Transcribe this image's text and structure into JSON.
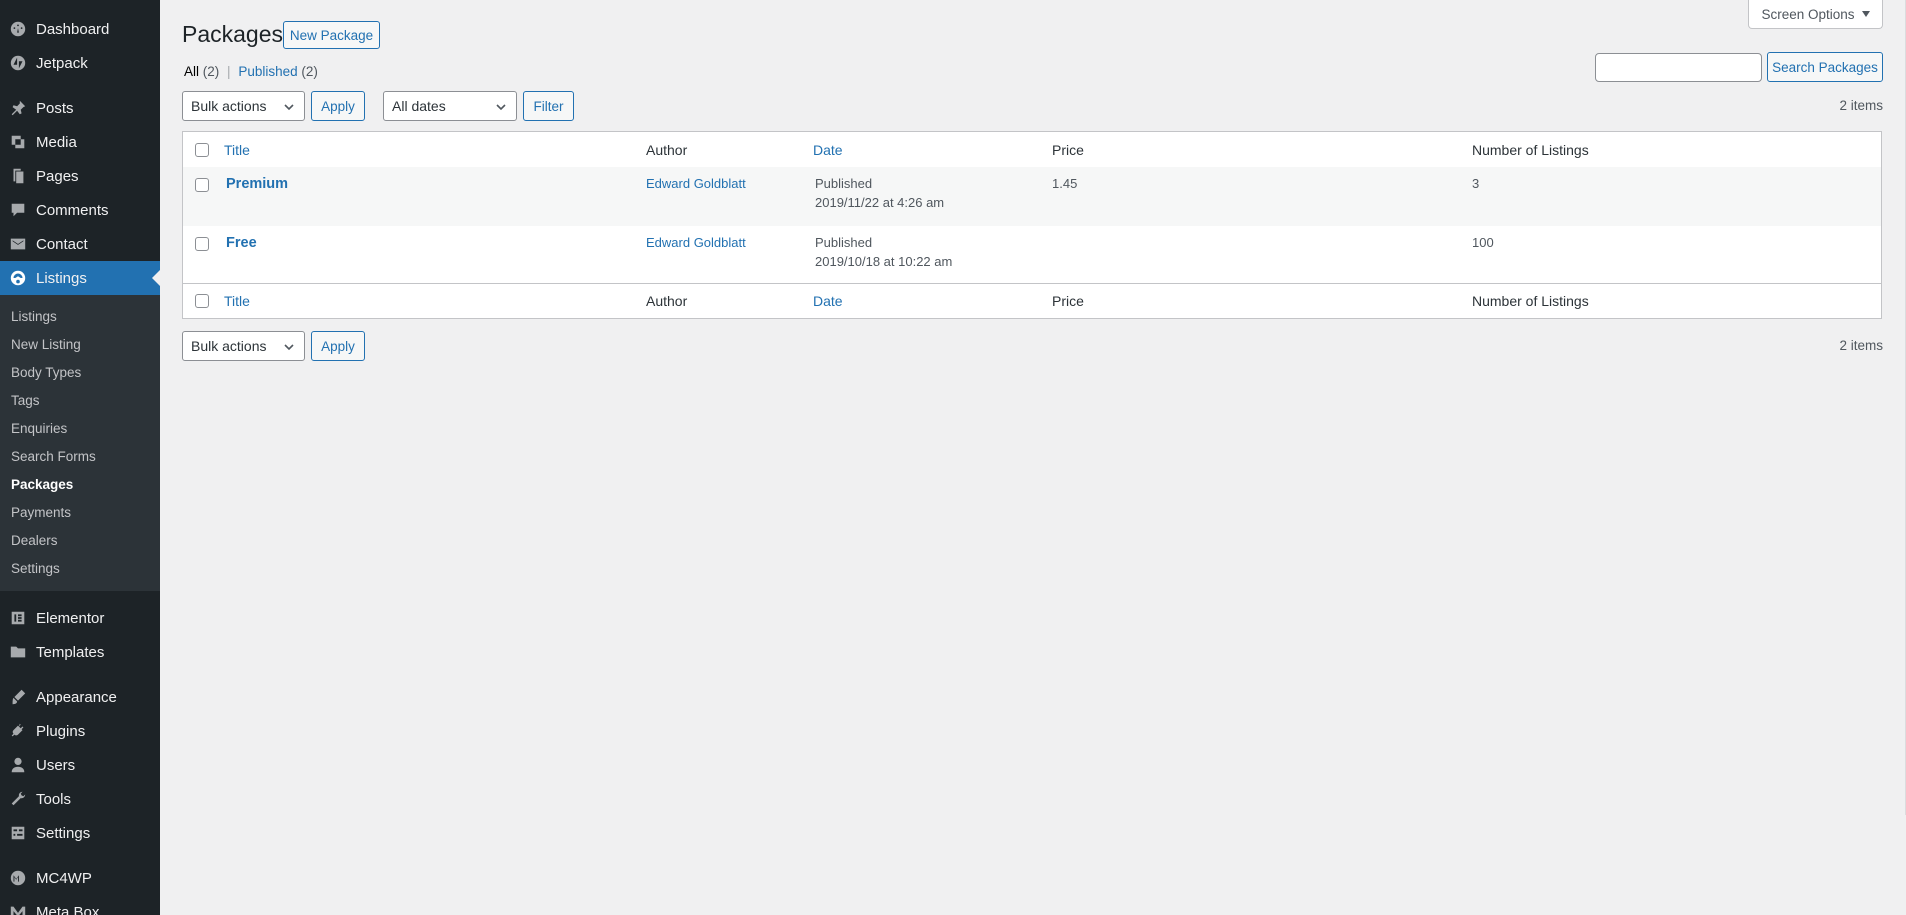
{
  "sidebar": {
    "top_items": [
      {
        "label": "Dashboard",
        "icon": "dashboard-icon"
      },
      {
        "label": "Jetpack",
        "icon": "jetpack-icon"
      },
      {
        "label": "Posts",
        "icon": "pin-icon"
      },
      {
        "label": "Media",
        "icon": "media-icon"
      },
      {
        "label": "Pages",
        "icon": "pages-icon"
      },
      {
        "label": "Comments",
        "icon": "comment-icon"
      },
      {
        "label": "Contact",
        "icon": "mail-icon"
      },
      {
        "label": "Listings",
        "icon": "car-icon"
      },
      {
        "label": "Elementor",
        "icon": "elementor-icon"
      },
      {
        "label": "Templates",
        "icon": "folder-icon"
      },
      {
        "label": "Appearance",
        "icon": "brush-icon"
      },
      {
        "label": "Plugins",
        "icon": "plug-icon"
      },
      {
        "label": "Users",
        "icon": "user-icon"
      },
      {
        "label": "Tools",
        "icon": "wrench-icon"
      },
      {
        "label": "Settings",
        "icon": "settings-icon"
      },
      {
        "label": "MC4WP",
        "icon": "mc4wp-icon"
      },
      {
        "label": "Meta Box",
        "icon": "metabox-icon"
      }
    ],
    "submenu": [
      "Listings",
      "New Listing",
      "Body Types",
      "Tags",
      "Enquiries",
      "Search Forms",
      "Packages",
      "Payments",
      "Dealers",
      "Settings"
    ],
    "current": "Listings",
    "active_submenu": "Packages"
  },
  "header": {
    "title": "Packages",
    "new_button": "New Package",
    "screen_options": "Screen Options"
  },
  "filters": {
    "all_label": "All",
    "all_count": "(2)",
    "separator": "|",
    "published_label": "Published",
    "published_count": "(2)"
  },
  "search": {
    "value": "",
    "button": "Search Packages"
  },
  "tablenav": {
    "bulk_actions": "Bulk actions",
    "apply": "Apply",
    "dates": "All dates",
    "filter": "Filter",
    "items_count": "2 items"
  },
  "table": {
    "columns": {
      "title": "Title",
      "author": "Author",
      "date": "Date",
      "price": "Price",
      "listings": "Number of Listings"
    },
    "rows": [
      {
        "title": "Premium",
        "author": "Edward Goldblatt",
        "status": "Published",
        "date": "2019/11/22 at 4:26 am",
        "price": "1.45",
        "listings": "3"
      },
      {
        "title": "Free",
        "author": "Edward Goldblatt",
        "status": "Published",
        "date": "2019/10/18 at 10:22 am",
        "price": "",
        "listings": "100"
      }
    ]
  },
  "colors": {
    "sidebar_bg": "#1d2327",
    "submenu_bg": "#2c3338",
    "accent": "#2271b1",
    "page_bg": "#f0f0f1"
  }
}
